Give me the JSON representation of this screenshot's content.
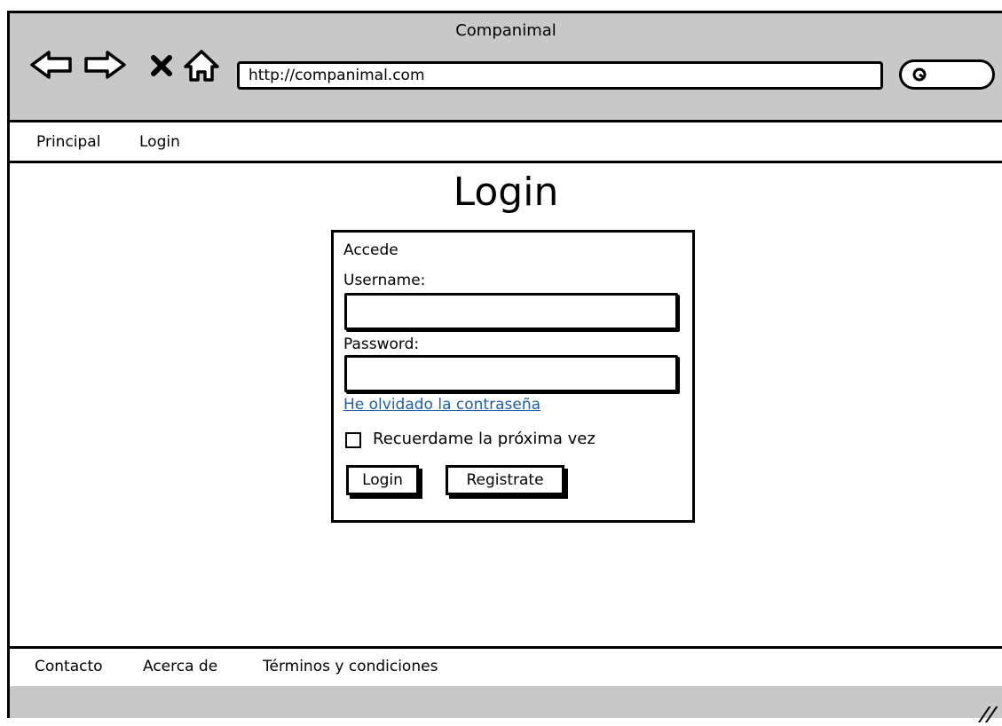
{
  "window": {
    "title": "Companimal"
  },
  "browser": {
    "url": "http://companimal.com",
    "icons": [
      "back-arrow-icon",
      "forward-arrow-icon",
      "close-x-icon",
      "home-icon",
      "search-icon"
    ]
  },
  "menu": {
    "items": [
      "Principal",
      "Login"
    ]
  },
  "page": {
    "title": "Login"
  },
  "login_panel": {
    "heading": "Accede",
    "username_label": "Username:",
    "username_value": "",
    "password_label": "Password:",
    "password_value": "",
    "forgot_link": "He olvidado la contraseña",
    "remember_label": "Recuerdame la próxima vez",
    "remember_checked": false,
    "login_button": "Login",
    "register_button": "Registrate"
  },
  "footer": {
    "items": [
      "Contacto",
      "Acerca de",
      "Términos y condiciones"
    ]
  },
  "colors": {
    "chrome": "#c8c8c8",
    "link": "#1f5fa8"
  }
}
